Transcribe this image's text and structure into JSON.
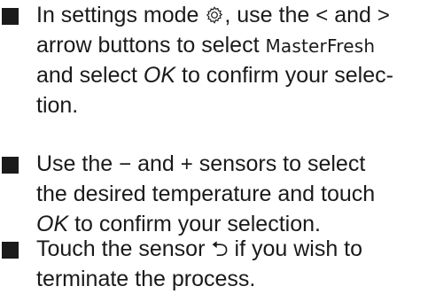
{
  "instructions": [
    {
      "line1_a": "In settings mode ",
      "gear_icon": "gear-icon",
      "line1_b": ", use the ",
      "lt": "<",
      "line1_c": " and ",
      "gt": ">",
      "line2_a": "arrow buttons to select ",
      "display_text": "MasterFresh",
      "line3_a": "and select ",
      "ok": "OK",
      "line3_b": " to confirm your selec-",
      "line4": "tion."
    },
    {
      "line1_a": "Use the ",
      "minus": "−",
      "line1_b": " and ",
      "plus": "+",
      "line1_c": " sensors to select",
      "line2": "the desired temperature and touch",
      "ok": "OK",
      "line3_b": " to confirm your selection."
    },
    {
      "line1_a": "Touch the sensor ",
      "back_icon": "back-arrow-icon",
      "back_symbol": "⮌",
      "line1_b": " if you wish to",
      "line2": "terminate the process."
    }
  ]
}
